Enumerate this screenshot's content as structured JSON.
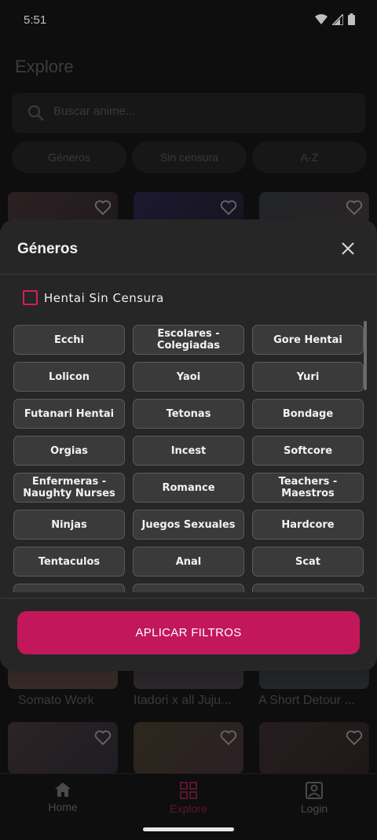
{
  "status": {
    "time": "5:51"
  },
  "page": {
    "title": "Explore"
  },
  "search": {
    "placeholder": "Buscar anime..."
  },
  "filters": {
    "chips": [
      "Géneros",
      "Sin censura",
      "A-Z"
    ]
  },
  "cards": {
    "titles": [
      "Somato Work",
      "Itadori x all Juju...",
      "A Short Detour ..."
    ]
  },
  "sheet": {
    "title": "Géneros",
    "uncensored_label": "Hentai Sin Censura",
    "genres": [
      "Ecchi",
      "Escolares - Colegiadas",
      "Gore Hentai",
      "Lolicon",
      "Yaoi",
      "Yuri",
      "Futanari Hentai",
      "Tetonas",
      "Bondage",
      "Orgias",
      "Incest",
      "Softcore",
      "Enfermeras - Naughty Nurses",
      "Romance",
      "Teachers - Maestros",
      "Ninjas",
      "Juegos Sexuales",
      "Hardcore",
      "Tentaculos",
      "Anal",
      "Scat",
      "",
      "",
      ""
    ],
    "apply_label": "APLICAR FILTROS"
  },
  "nav": {
    "home": "Home",
    "explore": "Explore",
    "login": "Login"
  },
  "colors": {
    "accent": "#c2185b",
    "sheet_bg": "#262626",
    "chip_bg": "#3a3a3a"
  }
}
